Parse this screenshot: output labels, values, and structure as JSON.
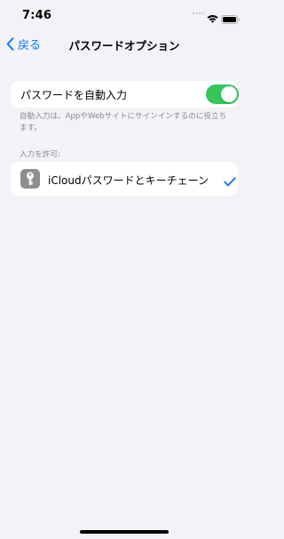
{
  "status_bar": {
    "time": "7:46"
  },
  "nav": {
    "back_label": "戻る",
    "title": "パスワードオプション"
  },
  "autofill": {
    "label": "パスワードを自動入力",
    "enabled": true
  },
  "footer_note": "自動入力は、AppやWebサイトにサインインするのに役立ちます。",
  "section_header": "入力を許可:",
  "provider": {
    "label": "iCloudパスワードとキーチェーン",
    "selected": true
  },
  "colors": {
    "accent": "#0a7aff",
    "toggle_on": "#34c759",
    "background": "#f2f2f7"
  }
}
